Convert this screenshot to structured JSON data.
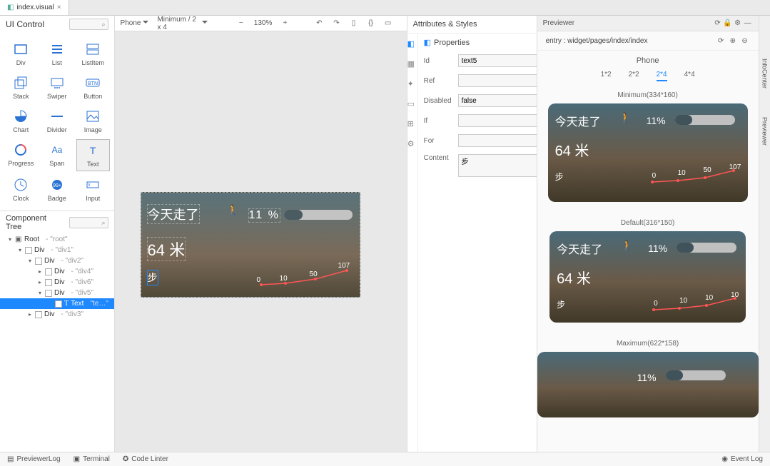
{
  "tab": {
    "name": "index.visual",
    "close": "×"
  },
  "ui_control": {
    "title": "UI Control",
    "components": [
      {
        "label": "Div",
        "icon": "div"
      },
      {
        "label": "List",
        "icon": "list"
      },
      {
        "label": "ListItem",
        "icon": "listitem"
      },
      {
        "label": "Stack",
        "icon": "stack"
      },
      {
        "label": "Swiper",
        "icon": "swiper"
      },
      {
        "label": "Button",
        "icon": "button"
      },
      {
        "label": "Chart",
        "icon": "chart"
      },
      {
        "label": "Divider",
        "icon": "divider"
      },
      {
        "label": "Image",
        "icon": "image"
      },
      {
        "label": "Progress",
        "icon": "progress"
      },
      {
        "label": "Span",
        "icon": "span"
      },
      {
        "label": "Text",
        "icon": "text"
      },
      {
        "label": "Clock",
        "icon": "clock"
      },
      {
        "label": "Badge",
        "icon": "badge"
      },
      {
        "label": "Input",
        "icon": "input"
      }
    ]
  },
  "component_tree": {
    "title": "Component\nTree",
    "nodes": [
      {
        "indent": 0,
        "expand": "down",
        "type": "Root",
        "name": "- \"root\"",
        "root": true
      },
      {
        "indent": 1,
        "expand": "down",
        "type": "Div",
        "name": "- \"div1\""
      },
      {
        "indent": 2,
        "expand": "down",
        "type": "Div",
        "name": "- \"div2\""
      },
      {
        "indent": 3,
        "expand": "right",
        "type": "Div",
        "name": "- \"div4\""
      },
      {
        "indent": 3,
        "expand": "right",
        "type": "Div",
        "name": "- \"div6\""
      },
      {
        "indent": 3,
        "expand": "down",
        "type": "Div",
        "name": "- \"div5\""
      },
      {
        "indent": 4,
        "expand": "",
        "type": "Text",
        "name": "\"te…\"",
        "selected": true,
        "icon": "T"
      },
      {
        "indent": 2,
        "expand": "right",
        "type": "Div",
        "name": "- \"div3\""
      }
    ]
  },
  "canvas_toolbar": {
    "device": "Phone",
    "size": "Minimum / 2 x 4",
    "zoom": "130%",
    "icons": [
      "minus",
      "plus",
      "undo",
      "redo",
      "ruler",
      "code",
      "responsive"
    ]
  },
  "widget": {
    "today_walked": "今天走了",
    "percent": "11  %",
    "distance": "64 米",
    "steps_label": "步"
  },
  "chart_data": {
    "type": "line",
    "categories": [
      "0",
      "10",
      "50",
      "107"
    ],
    "values": [
      0,
      10,
      50,
      107
    ],
    "xlabel": "",
    "ylabel": "",
    "ylim": [
      0,
      120
    ]
  },
  "attributes": {
    "panel_title": "Attributes & Styles",
    "section": "Properties",
    "fields": {
      "id_label": "Id",
      "id_value": "text5",
      "ref_label": "Ref",
      "ref_value": "",
      "disabled_label": "Disabled",
      "disabled_value": "false",
      "if_label": "If",
      "if_value": "",
      "for_label": "For",
      "for_value": "",
      "content_label": "Content",
      "content_value": "步"
    },
    "side_icons": [
      "props",
      "layout",
      "text",
      "border",
      "box",
      "fx"
    ]
  },
  "previewer": {
    "title": "Previewer",
    "top_icons": [
      "refresh",
      "lock",
      "gear",
      "minimize"
    ],
    "entry_label": "entry : widget/pages/index/index",
    "entry_icons": [
      "refresh",
      "zoom-in",
      "zoom-out"
    ],
    "device": "Phone",
    "sizes": [
      "1*2",
      "2*2",
      "2*4",
      "4*4"
    ],
    "active_size": "2*4",
    "blocks": [
      {
        "label": "Minimum(334*160)",
        "size": "min",
        "chart_vals": [
          "0",
          "10",
          "50",
          "107"
        ]
      },
      {
        "label": "Default(316*150)",
        "size": "def",
        "chart_vals": [
          "0",
          "10",
          "10",
          "10"
        ]
      },
      {
        "label": "Maximum(622*158)",
        "size": "max",
        "chart_vals": []
      }
    ],
    "preview_text": {
      "today_walked": "今天走了",
      "percent": "11%",
      "distance": "64 米",
      "steps": "步"
    }
  },
  "rails": {
    "info_center": "InfoCenter",
    "previewer": "Previewer"
  },
  "status_bar": {
    "items": [
      "PreviewerLog",
      "Terminal",
      "Code Linter"
    ],
    "right": "Event Log"
  },
  "colors": {
    "accent": "#1e88ff"
  }
}
